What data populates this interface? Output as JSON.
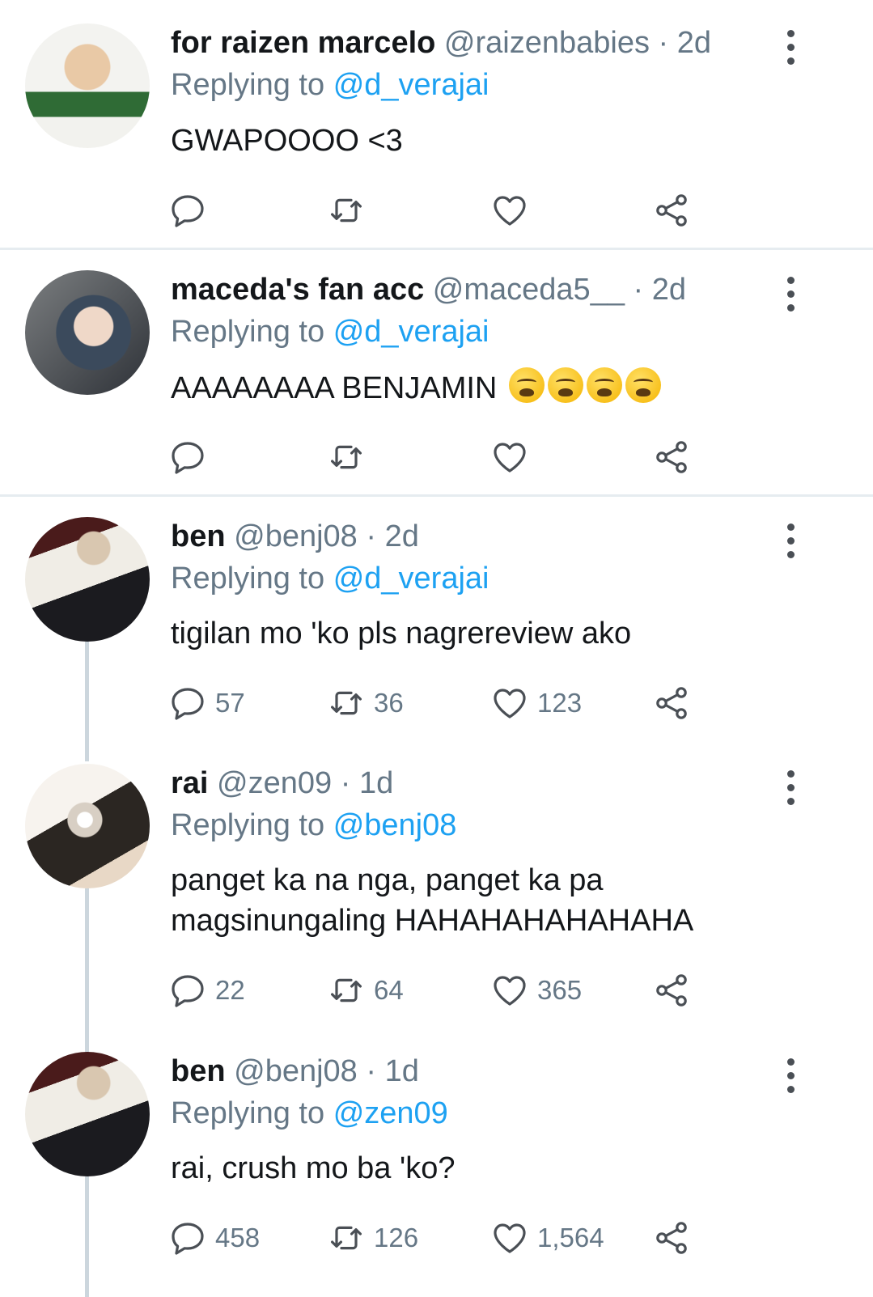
{
  "tweets": [
    {
      "name": "for raizen marcelo",
      "handle": "@raizenbabies",
      "time": "2d",
      "reply_prefix": "Replying to",
      "reply_to": "@d_verajai",
      "text": "GWAPOOOO <3",
      "counts": {
        "reply": "",
        "retweet": "",
        "like": ""
      }
    },
    {
      "name": "maceda's fan acc",
      "handle": "@maceda5__",
      "time": "2d",
      "reply_prefix": "Replying to",
      "reply_to": "@d_verajai",
      "text": "AAAAAAAA BENJAMIN",
      "emoji": [
        "weary-face-emoji",
        "weary-face-emoji",
        "weary-face-emoji",
        "weary-face-emoji"
      ],
      "counts": {
        "reply": "",
        "retweet": "",
        "like": ""
      }
    },
    {
      "name": "ben",
      "handle": "@benj08",
      "time": "2d",
      "reply_prefix": "Replying to",
      "reply_to": "@d_verajai",
      "text": "tigilan mo 'ko pls nagrereview ako",
      "counts": {
        "reply": "57",
        "retweet": "36",
        "like": "123"
      }
    },
    {
      "name": "rai",
      "handle": "@zen09",
      "time": "1d",
      "reply_prefix": "Replying to",
      "reply_to": "@benj08",
      "text": "panget ka na nga, panget ka pa magsinungaling HAHAHAHAHAHAHA",
      "counts": {
        "reply": "22",
        "retweet": "64",
        "like": "365"
      }
    },
    {
      "name": "ben",
      "handle": "@benj08",
      "time": "1d",
      "reply_prefix": "Replying to",
      "reply_to": "@zen09",
      "text": "rai, crush mo ba 'ko?",
      "counts": {
        "reply": "458",
        "retweet": "126",
        "like": "1,564"
      }
    }
  ],
  "separator": "·",
  "icons": {
    "reply": "reply-icon",
    "retweet": "retweet-icon",
    "like": "heart-icon",
    "share": "share-icon",
    "more": "more-options-icon"
  },
  "colors": {
    "link": "#1da1f2",
    "secondary_text": "#657786",
    "divider": "#e6ecf0",
    "thread_line": "#ccd6dd"
  }
}
